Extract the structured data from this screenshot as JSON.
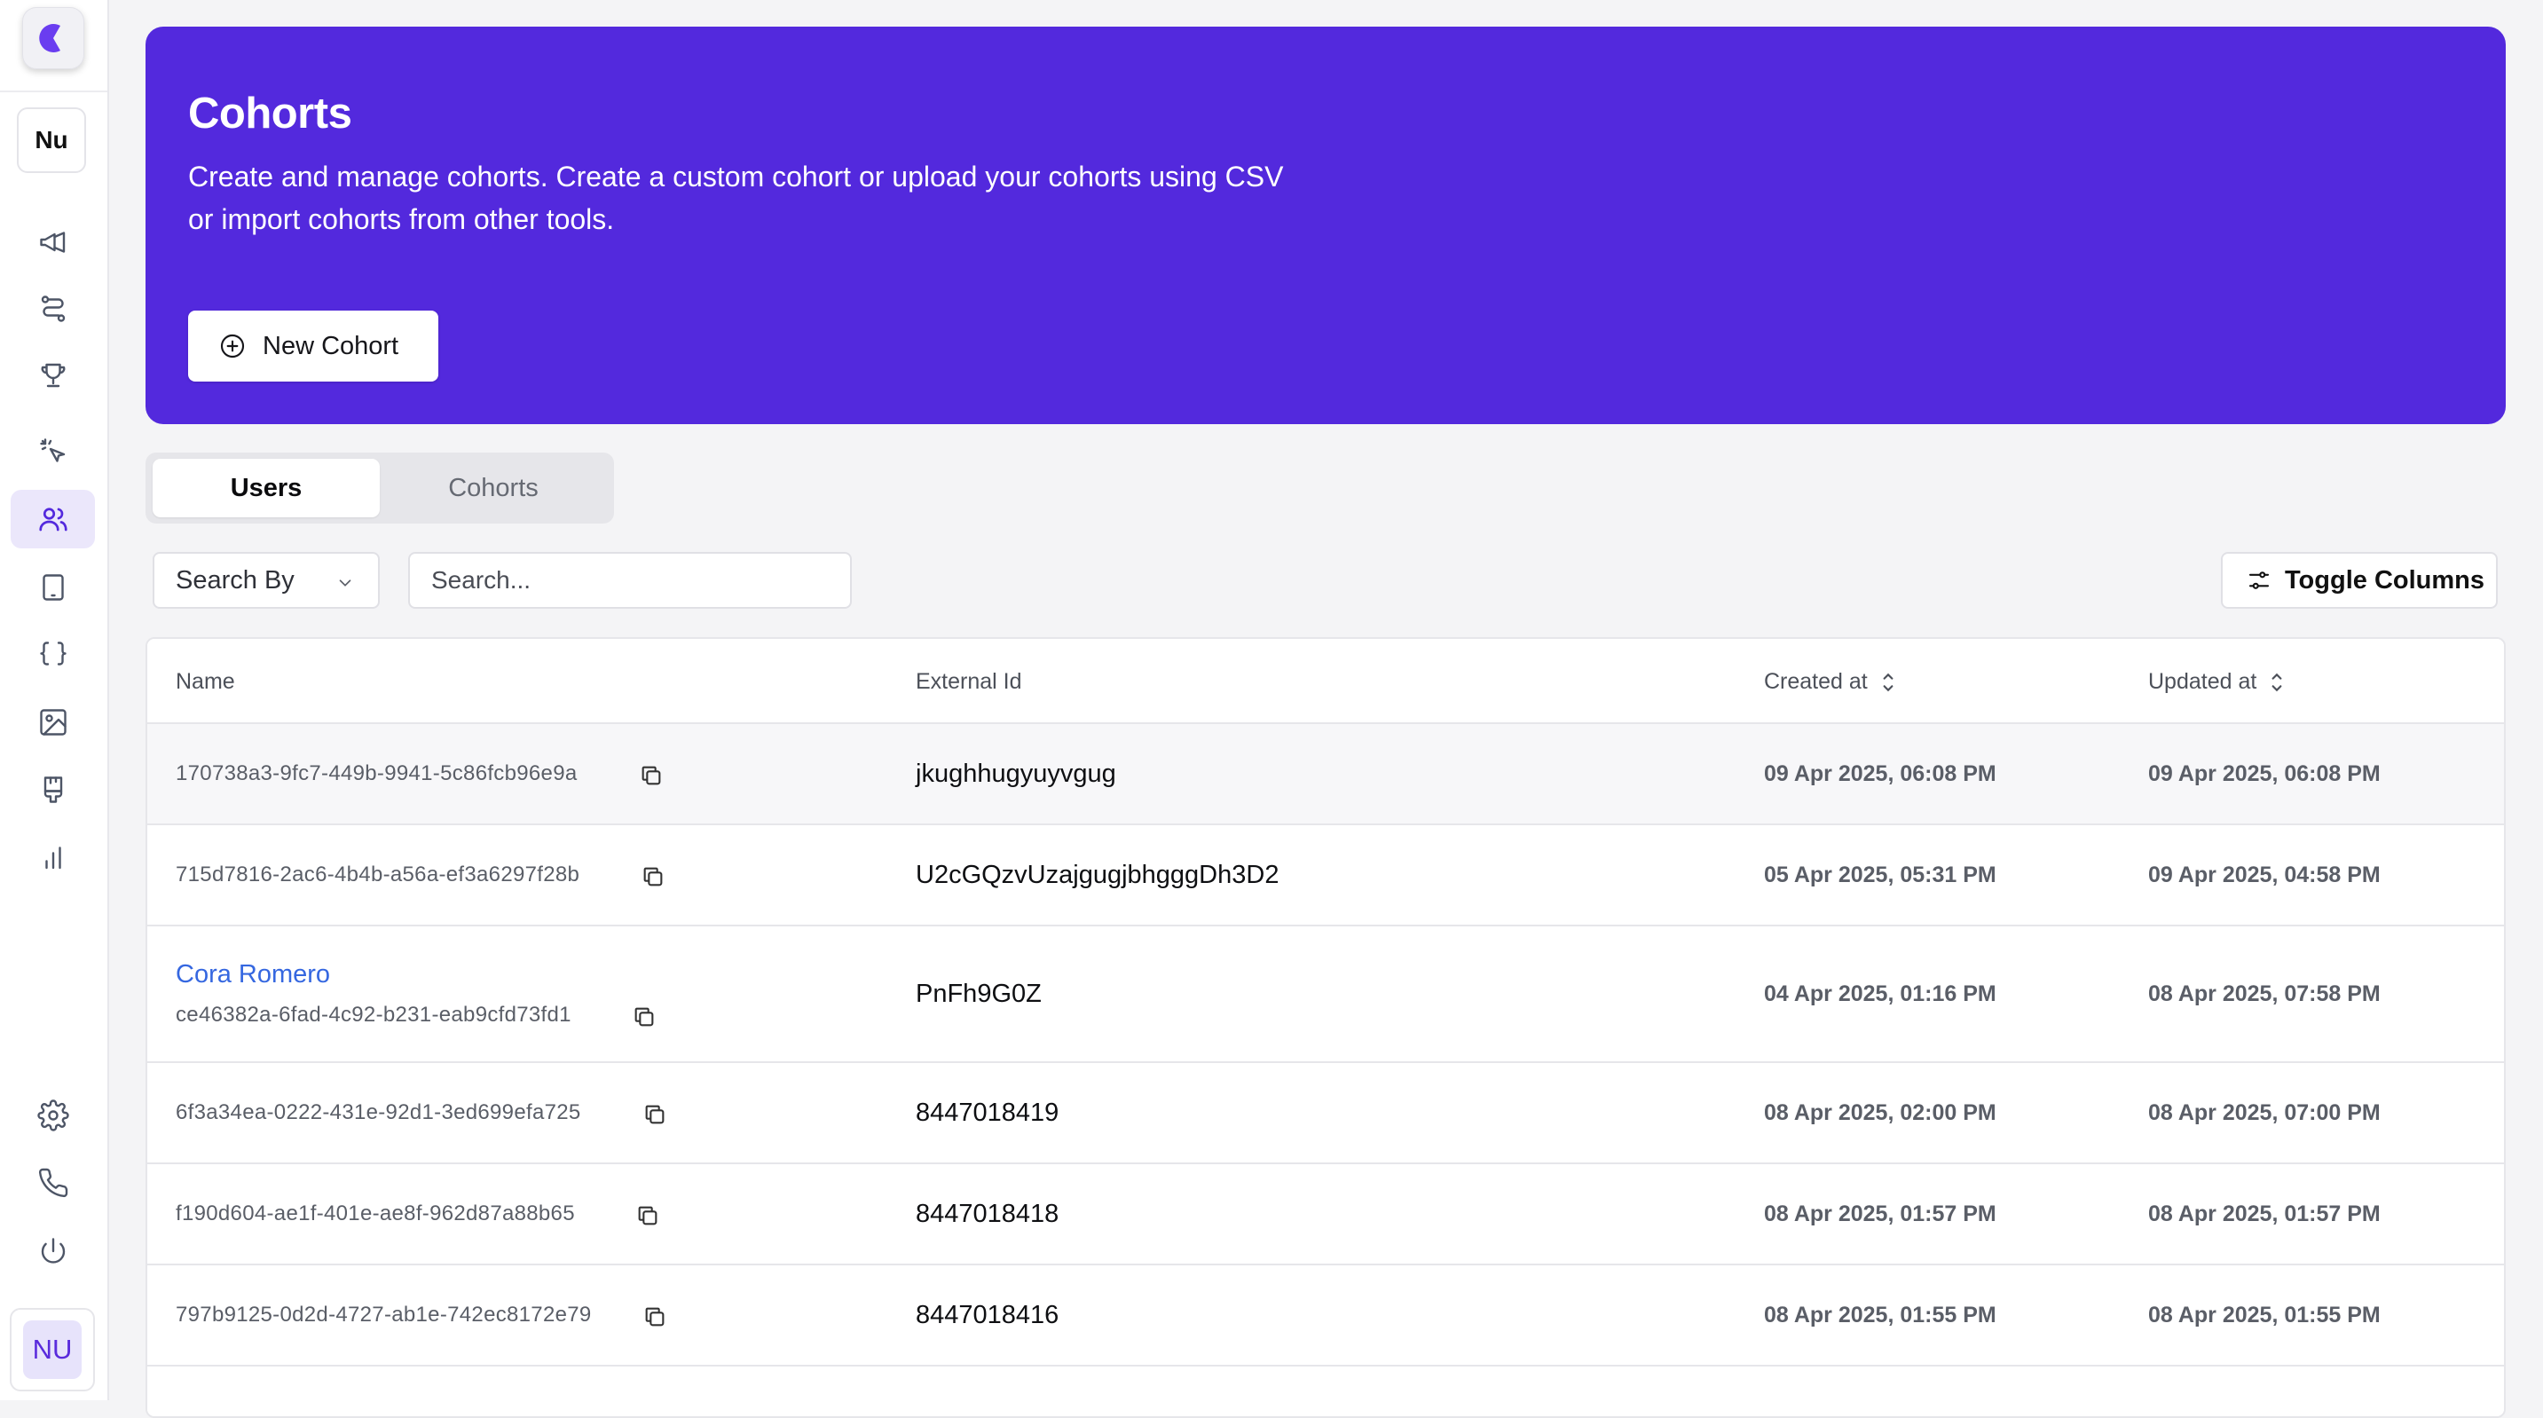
{
  "sidebar": {
    "workspace_label": "Nu",
    "avatar_initials": "NU",
    "nav_icons": [
      "megaphone-icon",
      "route-icon",
      "trophy-icon",
      "click-icon",
      "users-icon",
      "tablet-icon",
      "braces-icon",
      "image-icon",
      "brush-icon",
      "bar-chart-icon"
    ],
    "active_item": "users-icon",
    "bottom_icons": [
      "settings-icon",
      "phone-icon",
      "power-icon"
    ]
  },
  "hero": {
    "title": "Cohorts",
    "description": "Create and manage cohorts. Create a custom cohort or upload your cohorts using CSV or import cohorts from other tools.",
    "new_cohort_label": "New Cohort"
  },
  "tabs": {
    "users_label": "Users",
    "cohorts_label": "Cohorts",
    "active": "Users"
  },
  "toolbar": {
    "search_by_label": "Search By",
    "search_placeholder": "Search...",
    "toggle_columns_label": "Toggle Columns"
  },
  "table": {
    "headers": {
      "name": "Name",
      "external_id": "External Id",
      "created_at": "Created at",
      "updated_at": "Updated at"
    },
    "rows": [
      {
        "name": "",
        "id": "170738a3-9fc7-449b-9941-5c86fcb96e9a",
        "external_id": "jkughhugyuyvgug",
        "created_at": "09 Apr 2025, 06:08 PM",
        "updated_at": "09 Apr 2025, 06:08 PM"
      },
      {
        "name": "",
        "id": "715d7816-2ac6-4b4b-a56a-ef3a6297f28b",
        "external_id": "U2cGQzvUzajgugjbhgggDh3D2",
        "created_at": "05 Apr 2025, 05:31 PM",
        "updated_at": "09 Apr 2025, 04:58 PM"
      },
      {
        "name": "Cora Romero",
        "id": "ce46382a-6fad-4c92-b231-eab9cfd73fd1",
        "external_id": "PnFh9G0Z",
        "created_at": "04 Apr 2025, 01:16 PM",
        "updated_at": "08 Apr 2025, 07:58 PM"
      },
      {
        "name": "",
        "id": "6f3a34ea-0222-431e-92d1-3ed699efa725",
        "external_id": "8447018419",
        "created_at": "08 Apr 2025, 02:00 PM",
        "updated_at": "08 Apr 2025, 07:00 PM"
      },
      {
        "name": "",
        "id": "f190d604-ae1f-401e-ae8f-962d87a88b65",
        "external_id": "8447018418",
        "created_at": "08 Apr 2025, 01:57 PM",
        "updated_at": "08 Apr 2025, 01:57 PM"
      },
      {
        "name": "",
        "id": "797b9125-0d2d-4727-ab1e-742ec8172e79",
        "external_id": "8447018416",
        "created_at": "08 Apr 2025, 01:55 PM",
        "updated_at": "08 Apr 2025, 01:55 PM"
      }
    ]
  },
  "colors": {
    "brand": "#5329dd",
    "link": "#3567e0",
    "active_nav_bg": "#ebe7fb"
  }
}
